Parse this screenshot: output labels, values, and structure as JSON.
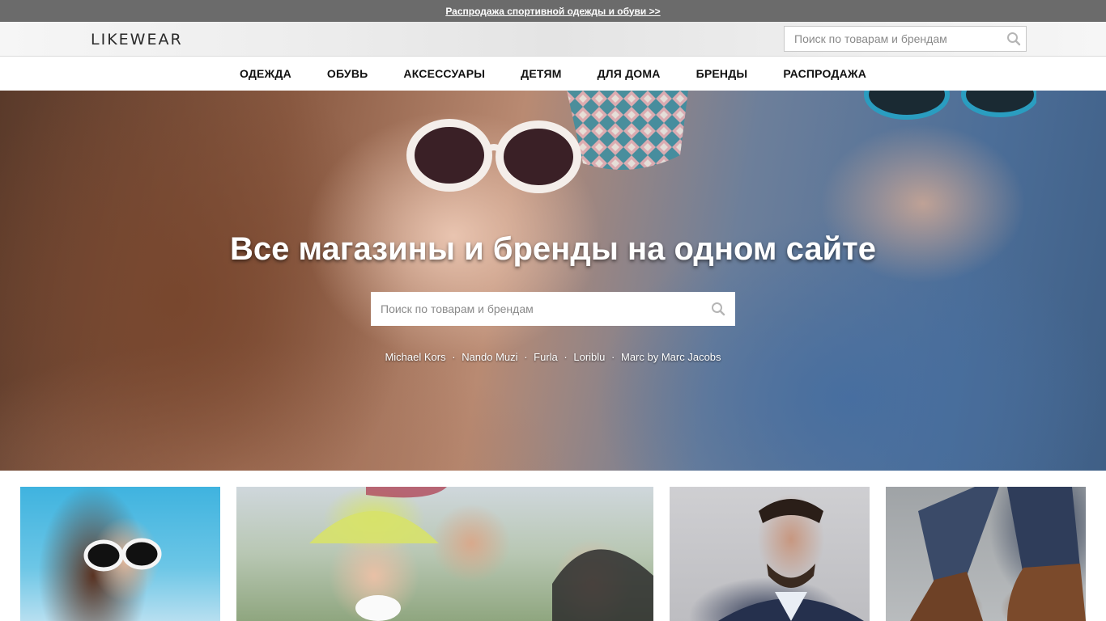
{
  "promo": {
    "text": "Распродажа спортивной одежды и обуви >>"
  },
  "header": {
    "logo": "LIKEWEAR",
    "search": {
      "placeholder": "Поиск по товарам и брендам",
      "icon": "search-icon"
    }
  },
  "nav": {
    "items": [
      {
        "label": "ОДЕЖДА"
      },
      {
        "label": "ОБУВЬ"
      },
      {
        "label": "АКСЕССУАРЫ"
      },
      {
        "label": "ДЕТЯМ"
      },
      {
        "label": "ДЛЯ ДОМА"
      },
      {
        "label": "БРЕНДЫ"
      },
      {
        "label": "РАСПРОДАЖА"
      }
    ]
  },
  "hero": {
    "title": "Все магазины и бренды на одном сайте",
    "search": {
      "placeholder": "Поиск по товарам и брендам",
      "icon": "search-icon"
    },
    "brands": [
      {
        "label": "Michael Kors"
      },
      {
        "label": "Nando Muzi"
      },
      {
        "label": "Furla"
      },
      {
        "label": "Loriblu"
      },
      {
        "label": "Marc by Marc Jacobs"
      }
    ],
    "separator": "·"
  },
  "cards": [
    {
      "image": "woman-sunglasses-photo"
    },
    {
      "image": "friends-group-photo"
    },
    {
      "image": "bearded-man-photo"
    },
    {
      "image": "leather-boots-photo"
    }
  ],
  "colors": {
    "promo_bg": "#6b6b6b",
    "nav_text": "#111111",
    "hero_text": "#ffffff"
  }
}
